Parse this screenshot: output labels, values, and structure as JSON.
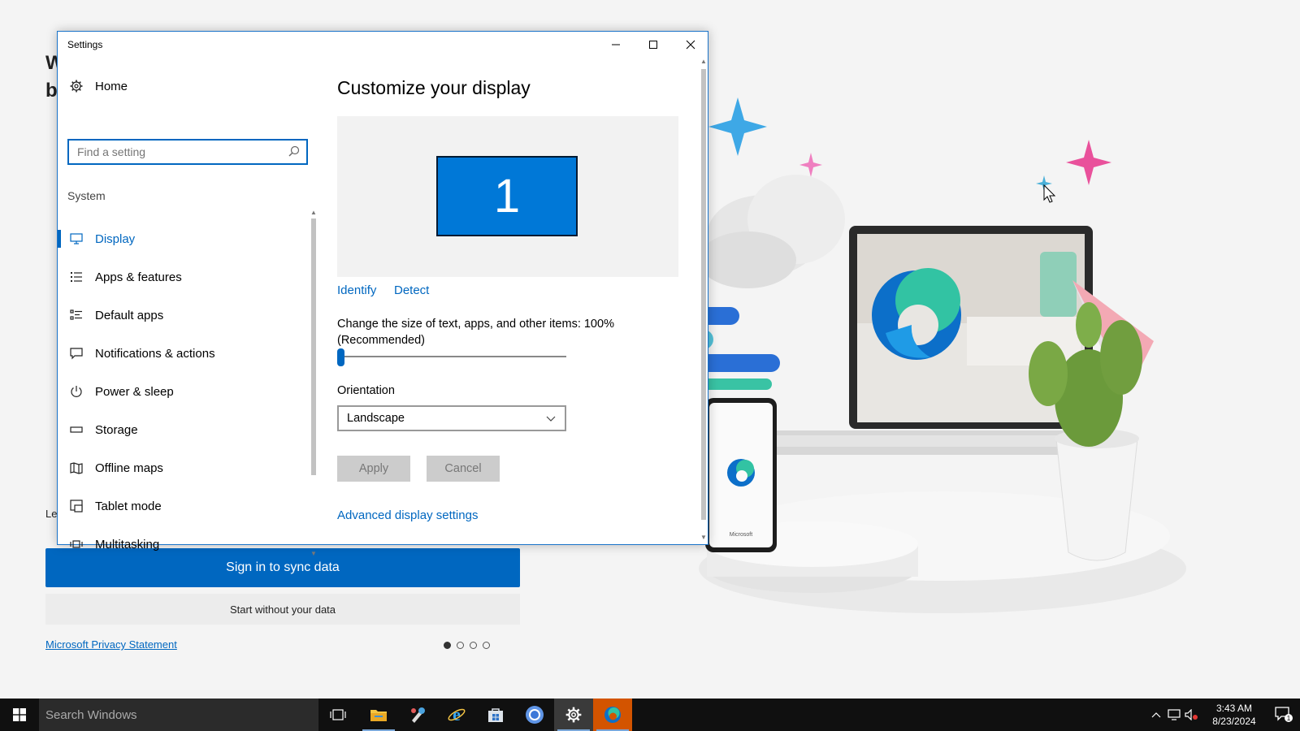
{
  "background": {
    "partial_heading_1": "W",
    "partial_heading_2": "b",
    "partial_text": "Le",
    "sign_in_label": "Sign in to sync data",
    "start_without_label": "Start without your data",
    "privacy_link": "Microsoft Privacy Statement",
    "pager_dots": 4,
    "pager_active": 0,
    "phone_brand": "Microsoft"
  },
  "settings": {
    "title": "Settings",
    "controls": {
      "minimize": "minimize-icon",
      "maximize": "maximize-icon",
      "close": "close-icon"
    },
    "sidebar": {
      "home_label": "Home",
      "search_placeholder": "Find a setting",
      "section_label": "System",
      "items": [
        {
          "label": "Display",
          "icon": "monitor-icon",
          "active": true
        },
        {
          "label": "Apps & features",
          "icon": "list-icon",
          "active": false
        },
        {
          "label": "Default apps",
          "icon": "default-apps-icon",
          "active": false
        },
        {
          "label": "Notifications & actions",
          "icon": "message-icon",
          "active": false
        },
        {
          "label": "Power & sleep",
          "icon": "power-icon",
          "active": false
        },
        {
          "label": "Storage",
          "icon": "storage-icon",
          "active": false
        },
        {
          "label": "Offline maps",
          "icon": "map-icon",
          "active": false
        },
        {
          "label": "Tablet mode",
          "icon": "tablet-icon",
          "active": false
        },
        {
          "label": "Multitasking",
          "icon": "multitask-icon",
          "active": false
        }
      ]
    },
    "main": {
      "page_title": "Customize your display",
      "monitor_number": "1",
      "identify_link": "Identify",
      "detect_link": "Detect",
      "scale_label": "Change the size of text, apps, and other items: 100% (Recommended)",
      "scale_value_percent": 0,
      "orientation_label": "Orientation",
      "orientation_value": "Landscape",
      "apply_label": "Apply",
      "cancel_label": "Cancel",
      "advanced_link": "Advanced display settings"
    }
  },
  "taskbar": {
    "search_placeholder": "Search Windows",
    "apps": [
      "task-view-icon",
      "file-explorer-icon",
      "paint-icon",
      "internet-explorer-icon",
      "store-icon",
      "chrome-icon",
      "settings-icon",
      "edge-icon"
    ],
    "time": "3:43 AM",
    "date": "8/23/2024",
    "notification_count": "1"
  },
  "colors": {
    "accent": "#0067c0",
    "monitor": "#0078d7",
    "taskbar": "#101010"
  }
}
